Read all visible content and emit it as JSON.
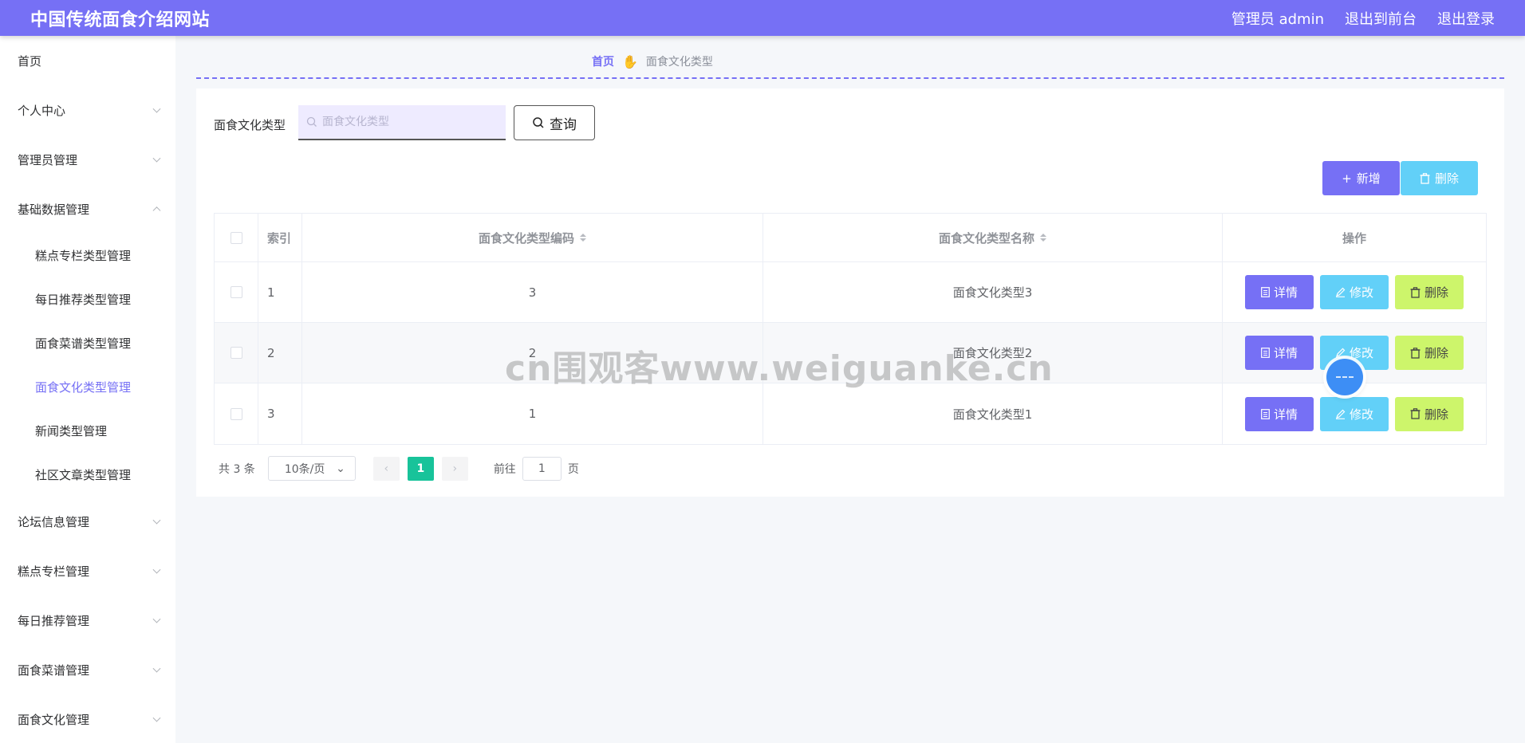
{
  "header": {
    "site_title": "中国传统面食介绍网站",
    "user_label": "管理员 admin",
    "frontend_link": "退出到前台",
    "logout_link": "退出登录"
  },
  "sidebar": {
    "items": [
      {
        "label": "首页",
        "expandable": false
      },
      {
        "label": "个人中心",
        "expandable": true
      },
      {
        "label": "管理员管理",
        "expandable": true
      },
      {
        "label": "基础数据管理",
        "expandable": true,
        "expanded": true
      },
      {
        "label": "论坛信息管理",
        "expandable": true
      },
      {
        "label": "糕点专栏管理",
        "expandable": true
      },
      {
        "label": "每日推荐管理",
        "expandable": true
      },
      {
        "label": "面食菜谱管理",
        "expandable": true
      },
      {
        "label": "面食文化管理",
        "expandable": true
      }
    ],
    "subitems": [
      {
        "label": "糕点专栏类型管理"
      },
      {
        "label": "每日推荐类型管理"
      },
      {
        "label": "面食菜谱类型管理"
      },
      {
        "label": "面食文化类型管理",
        "active": true
      },
      {
        "label": "新闻类型管理"
      },
      {
        "label": "社区文章类型管理"
      }
    ]
  },
  "breadcrumb": {
    "home": "首页",
    "separator_icon": "hand-pointer-icon",
    "current": "面食文化类型"
  },
  "search": {
    "label": "面食文化类型",
    "placeholder": "面食文化类型",
    "value": "",
    "query_button": "查询"
  },
  "actions": {
    "add_label": "新增",
    "delete_label": "删除"
  },
  "table": {
    "columns": [
      "索引",
      "面食文化类型编码",
      "面食文化类型名称",
      "操作"
    ],
    "rows": [
      {
        "index": "1",
        "code": "3",
        "name": "面食文化类型3"
      },
      {
        "index": "2",
        "code": "2",
        "name": "面食文化类型2"
      },
      {
        "index": "3",
        "code": "1",
        "name": "面食文化类型1"
      }
    ],
    "row_actions": {
      "detail": "详情",
      "edit": "修改",
      "delete": "删除"
    }
  },
  "pagination": {
    "total": "共 3 条",
    "page_size": "10条/页",
    "current_page": "1",
    "goto_label": "前往",
    "goto_value": "1",
    "page_suffix": "页"
  },
  "watermark": "cn围观客www.weiguanke.cn",
  "colors": {
    "primary": "#7670f5",
    "info": "#62d0f8",
    "warning": "#cdf56b",
    "pager_active": "#18c39a"
  }
}
